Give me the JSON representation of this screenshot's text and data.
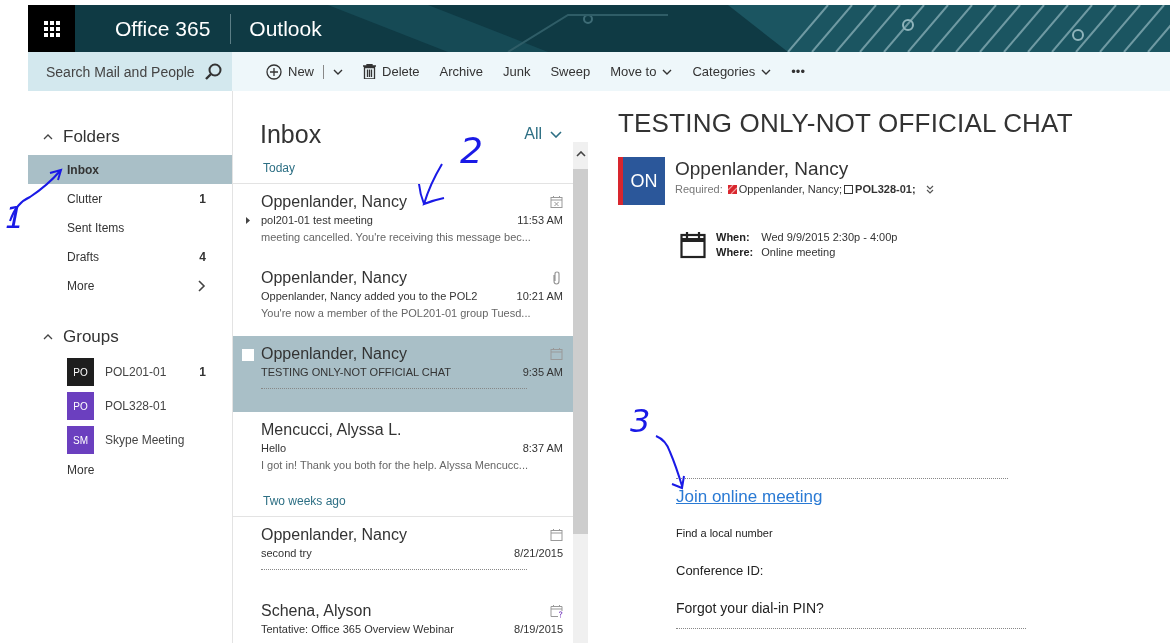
{
  "header": {
    "suite": "Office 365",
    "app": "Outlook"
  },
  "search": {
    "placeholder": "Search Mail and People"
  },
  "toolbar": [
    {
      "label": "New",
      "kind": "new"
    },
    {
      "label": "Delete",
      "kind": "delete"
    },
    {
      "label": "Archive",
      "kind": "plain"
    },
    {
      "label": "Junk",
      "kind": "plain"
    },
    {
      "label": "Sweep",
      "kind": "plain"
    },
    {
      "label": "Move to",
      "kind": "menu"
    },
    {
      "label": "Categories",
      "kind": "menu"
    },
    {
      "label": "•••",
      "kind": "plain"
    }
  ],
  "folders": {
    "heading": "Folders",
    "expanded": true,
    "items": [
      {
        "label": "Inbox",
        "selected": true
      },
      {
        "label": "Clutter",
        "count": "1",
        "selected": false
      },
      {
        "label": "Sent Items",
        "selected": false
      },
      {
        "label": "Drafts",
        "count": "4",
        "selected": false
      },
      {
        "label": "More",
        "kind": "more",
        "selected": false
      }
    ]
  },
  "groups": {
    "heading": "Groups",
    "expanded": true,
    "items": [
      {
        "initials": "PO",
        "name": "POL201-01",
        "count": "1",
        "color": "#1e1e1e"
      },
      {
        "initials": "PO",
        "name": "POL328-01",
        "color": "#6b3fbf"
      },
      {
        "initials": "SM",
        "name": "Skype Meeting",
        "color": "#6b3fbf"
      }
    ],
    "more": "More"
  },
  "message_list": {
    "title": "Inbox",
    "filter": "All",
    "sections": [
      {
        "label": "Today",
        "messages": [
          {
            "sender": "Oppenlander, Nancy",
            "subject": "pol201-01 test meeting",
            "time": "11:53 AM",
            "preview": "meeting cancelled. You're receiving this message bec...",
            "kind": "meeting-cancelled",
            "thread": true,
            "selected": false
          },
          {
            "sender": "Oppenlander, Nancy",
            "subject": "Oppenlander, Nancy added you to the POL2",
            "time": "10:21 AM",
            "preview": "You're now a member of the POL201-01 group Tuesd...",
            "kind": "attachment",
            "thread": false,
            "selected": false
          },
          {
            "sender": "Oppenlander, Nancy",
            "subject": "TESTING ONLY-NOT OFFICIAL CHAT",
            "time": "9:35 AM",
            "kind": "meeting",
            "thread": false,
            "selected": true
          },
          {
            "sender": "Mencucci, Alyssa L.",
            "subject": "Hello",
            "time": "8:37 AM",
            "preview": "I got in! Thank you both for the help. Alyssa Mencucc...",
            "thread": false,
            "selected": false
          }
        ]
      },
      {
        "label": "Two weeks ago",
        "messages": [
          {
            "sender": "Oppenlander, Nancy",
            "subject": "second try",
            "time": "8/21/2015",
            "kind": "meeting",
            "thread": false,
            "selected": false
          },
          {
            "sender": "Schena, Alyson",
            "subject": "Tentative: Office 365 Overview Webinar",
            "time": "8/19/2015",
            "kind": "meeting-tentative",
            "thread": false,
            "selected": false
          }
        ]
      }
    ]
  },
  "reading": {
    "subject": "TESTING ONLY-NOT OFFICIAL CHAT",
    "initials": "ON",
    "sender": "Oppenlander, Nancy",
    "required_label": "Required:",
    "attendees": [
      {
        "name": "Oppenlander, Nancy;",
        "kind": "organizer"
      },
      {
        "name": "POL328-01;",
        "kind": "group"
      }
    ],
    "when_label": "When:",
    "when": "Wed 9/9/2015 2:30p - 4:00p",
    "where_label": "Where:",
    "where": "Online meeting",
    "link": "Join online meeting",
    "local_number": "Find a local number",
    "conference_id": "Conference ID:",
    "pin": "Forgot your dial-in PIN?"
  },
  "annotations": [
    {
      "label": "1"
    },
    {
      "label": "2"
    },
    {
      "label": "3"
    }
  ]
}
